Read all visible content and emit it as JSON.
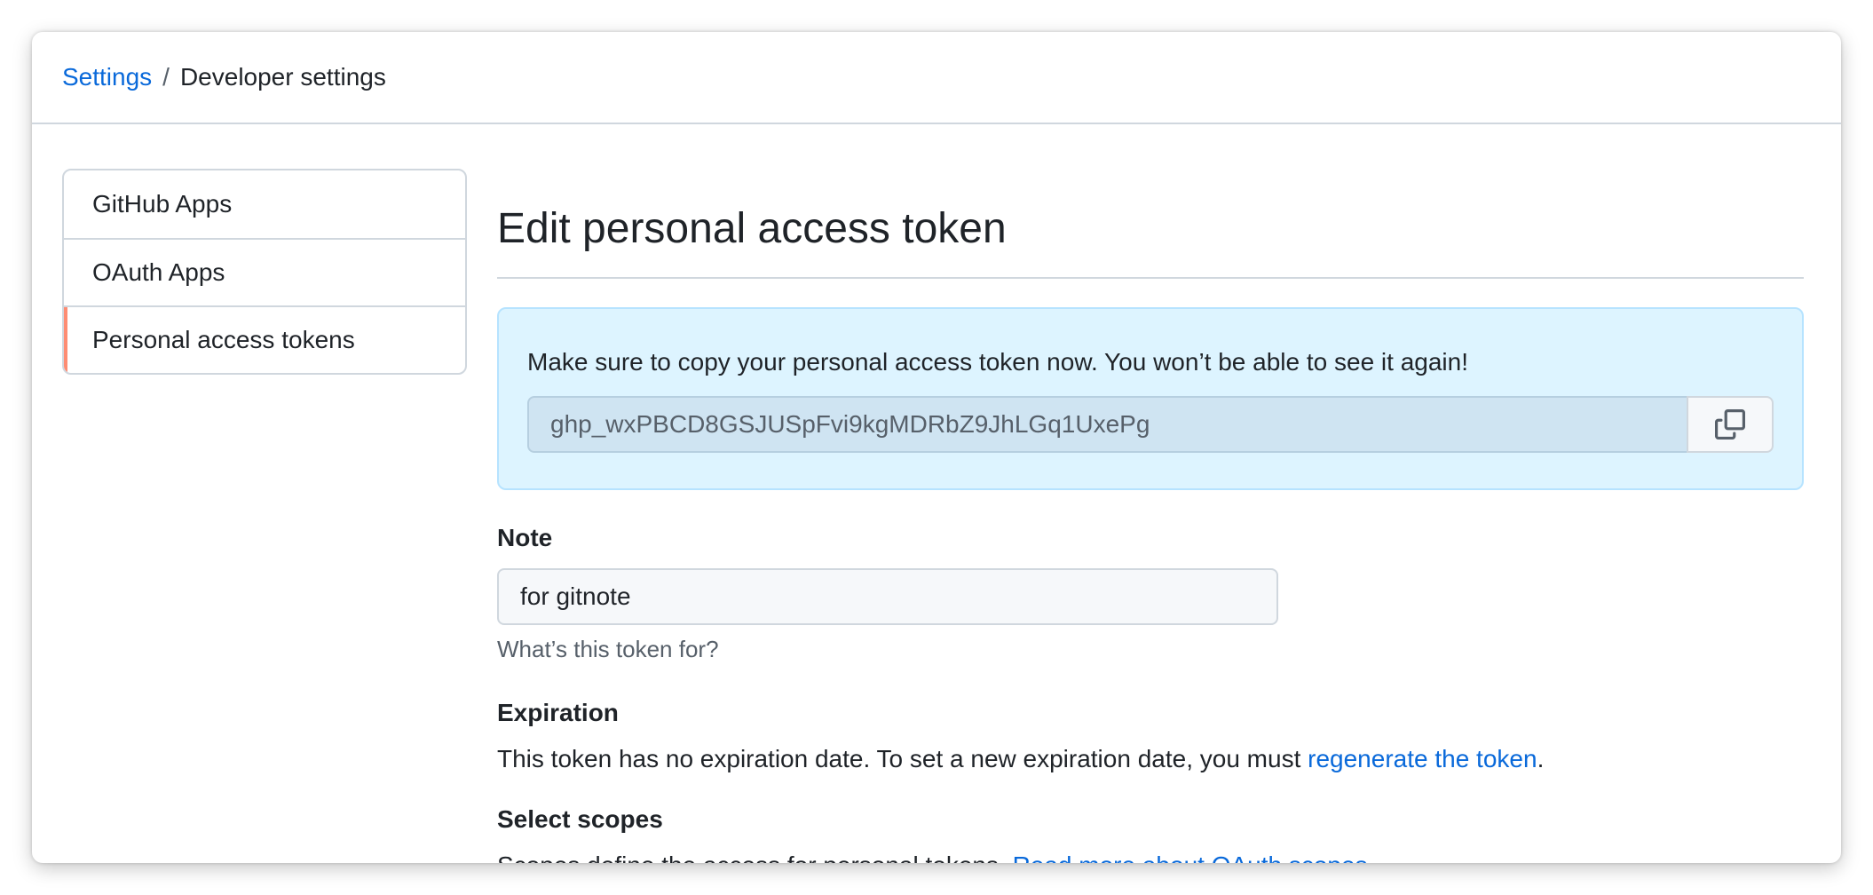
{
  "breadcrumb": {
    "root": "Settings",
    "separator": "/",
    "current": "Developer settings"
  },
  "sidebar": {
    "items": [
      {
        "label": "GitHub Apps"
      },
      {
        "label": "OAuth Apps"
      },
      {
        "label": "Personal access tokens",
        "active": true
      }
    ]
  },
  "main": {
    "title": "Edit personal access token",
    "flash": {
      "message": "Make sure to copy your personal access token now. You won’t be able to see it again!",
      "token": "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",
      "copy_icon": "copy-icon"
    },
    "note": {
      "label": "Note",
      "value": "for gitnote",
      "hint": "What’s this token for?"
    },
    "expiration": {
      "label": "Expiration",
      "text": "This token has no expiration date. To set a new expiration date, you must ",
      "link": "regenerate the token",
      "suffix": "."
    },
    "scopes": {
      "label": "Select scopes",
      "text": "Scopes define the access for personal tokens. ",
      "link": "Read more about OAuth scopes."
    }
  },
  "colors": {
    "link": "#0969da",
    "active_indicator": "#fd8c73",
    "flash_bg": "#ddf4ff",
    "flash_border": "#b6e3ff"
  }
}
